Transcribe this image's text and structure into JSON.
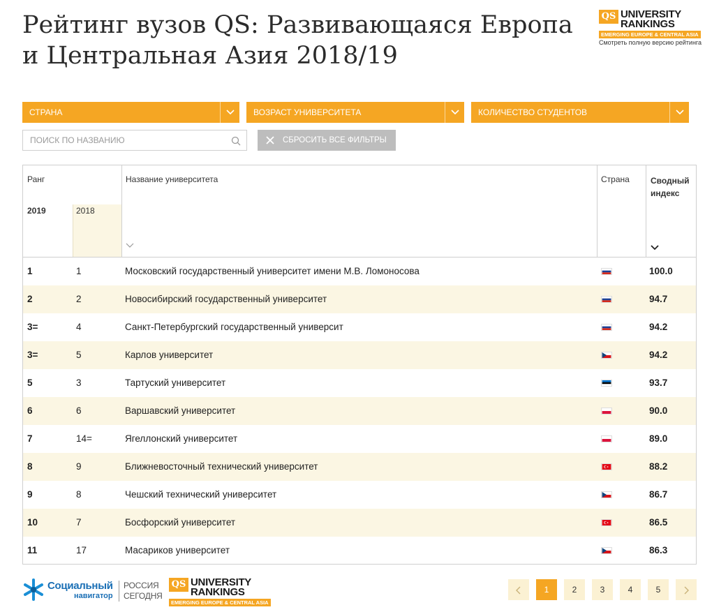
{
  "header": {
    "title_line1": "Рейтинг вузов QS: Развивающаяся Европа",
    "title_line2": "и Центральная Азия 2018/19",
    "qs_mark": "QS",
    "qs_line1": "UNIVERSITY",
    "qs_line2": "RANKINGS",
    "qs_sub": "EMERGING EUROPE & CENTRAL ASIA",
    "full_version_link": "Смотреть полную версию рейтинга"
  },
  "filters": {
    "country": "СТРАНА",
    "age": "ВОЗРАСТ УНИВЕРСИТЕТА",
    "students": "КОЛИЧЕСТВО СТУДЕНТОВ"
  },
  "search": {
    "placeholder": "ПОИСК ПО НАЗВАНИЮ"
  },
  "reset_label": "СБРОСИТЬ ВСЕ ФИЛЬТРЫ",
  "table": {
    "headers": {
      "rank": "Ранг",
      "year2019": "2019",
      "year2018": "2018",
      "name": "Название университета",
      "country": "Страна",
      "score_line1": "Сводный",
      "score_line2": "индекс"
    },
    "rows": [
      {
        "r2019": "1",
        "r2018": "1",
        "name": "Московский государственный университет имени М.В. Ломоносова",
        "flag": "ru",
        "score": "100.0"
      },
      {
        "r2019": "2",
        "r2018": "2",
        "name": "Новосибирский государственный университет",
        "flag": "ru",
        "score": "94.7"
      },
      {
        "r2019": "3=",
        "r2018": "4",
        "name": "Санкт-Петербургский государственный университ",
        "flag": "ru",
        "score": "94.2"
      },
      {
        "r2019": "3=",
        "r2018": "5",
        "name": "Карлов университет",
        "flag": "cz",
        "score": "94.2"
      },
      {
        "r2019": "5",
        "r2018": "3",
        "name": "Тартуский университет",
        "flag": "ee",
        "score": "93.7"
      },
      {
        "r2019": "6",
        "r2018": "6",
        "name": "Варшавский университет",
        "flag": "pl",
        "score": "90.0"
      },
      {
        "r2019": "7",
        "r2018": "14=",
        "name": "Ягеллонский университет",
        "flag": "pl",
        "score": "89.0"
      },
      {
        "r2019": "8",
        "r2018": "9",
        "name": "Ближневосточный технический университет",
        "flag": "tr",
        "score": "88.2"
      },
      {
        "r2019": "9",
        "r2018": "8",
        "name": "Чешский технический университет",
        "flag": "cz",
        "score": "86.7"
      },
      {
        "r2019": "10",
        "r2018": "7",
        "name": "Босфорский университет",
        "flag": "tr",
        "score": "86.5"
      },
      {
        "r2019": "11",
        "r2018": "17",
        "name": "Масариков университет",
        "flag": "cz",
        "score": "86.3"
      }
    ]
  },
  "footer": {
    "sn_main": "Социальный",
    "sn_sub": "навигатор",
    "rs_line1": "РОССИЯ",
    "rs_line2": "СЕГОДНЯ",
    "pages": [
      "1",
      "2",
      "3",
      "4",
      "5"
    ],
    "active_page": "1"
  },
  "colors": {
    "accent": "#f5a623",
    "stripe": "#fbf6e3",
    "reset_bg": "#bdbdbd",
    "brand_blue": "#1a6fb5"
  },
  "icons": {
    "dropdown": "chevron-down-icon",
    "search": "search-icon",
    "reset": "close-icon",
    "sort": "chevron-down-icon",
    "prev": "chevron-left-icon",
    "next": "chevron-right-icon"
  }
}
